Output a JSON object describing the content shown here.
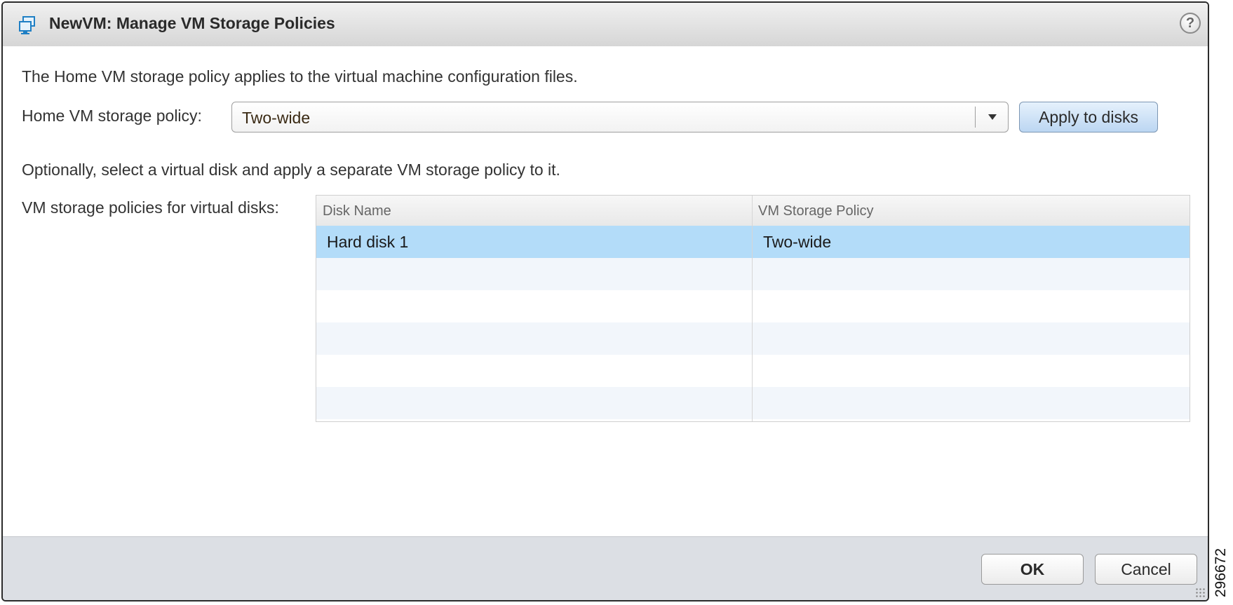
{
  "window": {
    "title": "NewVM: Manage VM Storage Policies",
    "help_glyph": "?"
  },
  "intro_text": "The Home VM storage policy applies to the virtual machine configuration files.",
  "home_policy": {
    "label": "Home VM storage policy:",
    "selected": "Two-wide",
    "apply_label": "Apply to disks"
  },
  "optional_text": "Optionally, select a virtual disk and apply a separate VM storage policy to it.",
  "disks": {
    "label": "VM storage policies for virtual disks:",
    "columns": [
      "Disk Name",
      "VM Storage Policy"
    ],
    "rows": [
      {
        "disk": "Hard disk 1",
        "policy": "Two-wide",
        "selected": true
      }
    ]
  },
  "footer": {
    "ok_label": "OK",
    "cancel_label": "Cancel"
  },
  "figure_id": "296672",
  "colors": {
    "selected_row": "#b3dcf9",
    "apply_button": "#bcd6f2",
    "footer_bg": "#dcdfe4"
  },
  "icons": {
    "title": "vm-icon",
    "help": "help-icon",
    "dropdown": "chevron-down-icon",
    "resize": "resize-grip-icon"
  }
}
